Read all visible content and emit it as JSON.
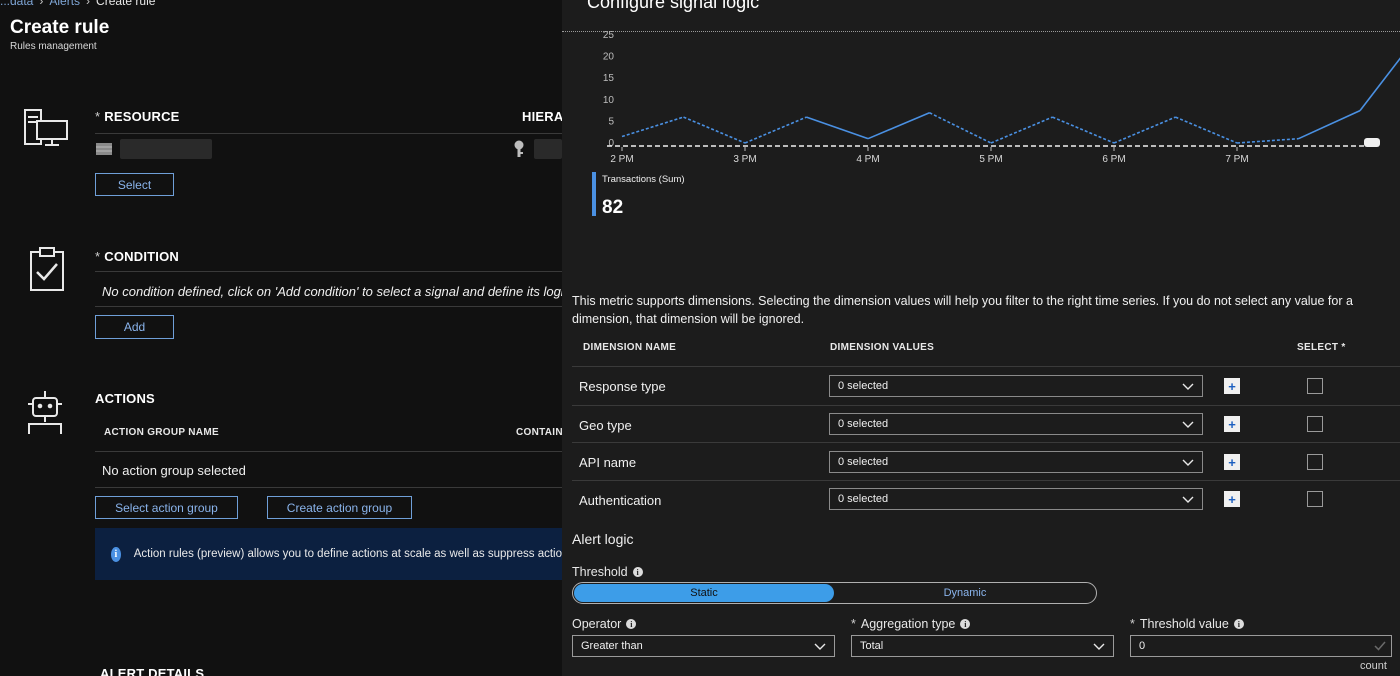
{
  "breadcrumb": {
    "items": [
      "...data",
      "Alerts",
      "Create rule"
    ]
  },
  "page": {
    "title": "Create rule",
    "subtitle": "Rules management"
  },
  "resource": {
    "label": "RESOURCE",
    "hierarchy_label": "HIERA",
    "select_button": "Select",
    "icon": "server-monitor-icon"
  },
  "condition": {
    "label": "CONDITION",
    "empty_text": "No condition defined, click on 'Add condition' to select a signal and define its logic",
    "add_button": "Add",
    "icon": "clipboard-check-icon"
  },
  "actions": {
    "label": "ACTIONS",
    "col_group_name": "ACTION GROUP NAME",
    "col_contains": "CONTAIN",
    "empty_text": "No action group selected",
    "select_button": "Select action group",
    "create_button": "Create action group",
    "icon": "robot-icon",
    "banner_text": "Action rules (preview) allows you to define actions at scale as well as suppress actio"
  },
  "alert_details": {
    "label": "ALERT DETAILS"
  },
  "signal_panel": {
    "title": "Configure signal logic",
    "chart_data": {
      "type": "line",
      "x_ticks": [
        "2 PM",
        "3 PM",
        "4 PM",
        "5 PM",
        "6 PM",
        "7 PM"
      ],
      "y_ticks": [
        "25",
        "20",
        "15",
        "10",
        "5",
        "0"
      ],
      "ylim": [
        0,
        25
      ],
      "series": [
        {
          "name": "Transactions (Sum)",
          "x": [
            0,
            0.5,
            1,
            1.5,
            2,
            2.5,
            3,
            3.5,
            4,
            4.5,
            5,
            5.5,
            6,
            6.5
          ],
          "y": [
            1.5,
            6,
            0,
            6,
            1,
            7,
            0,
            6,
            0,
            6,
            0,
            1,
            7.5,
            26
          ],
          "dashed_segments": [
            0,
            1,
            2,
            5,
            6,
            7,
            8,
            9,
            10
          ]
        }
      ],
      "threshold_line": 0
    },
    "legend": {
      "label": "Transactions (Sum)",
      "value": "82"
    },
    "dimension_desc": "This metric supports dimensions. Selecting the dimension values will help you filter to the right time series. If you do not select any value for a dimension, that dimension will be ignored.",
    "dimensions": {
      "col_name": "DIMENSION NAME",
      "col_values": "DIMENSION VALUES",
      "col_select": "SELECT *",
      "rows": [
        {
          "name": "Response type",
          "value": "0 selected"
        },
        {
          "name": "Geo type",
          "value": "0 selected"
        },
        {
          "name": "API name",
          "value": "0 selected"
        },
        {
          "name": "Authentication",
          "value": "0 selected"
        }
      ]
    },
    "alert_logic": {
      "heading": "Alert logic",
      "threshold_label": "Threshold",
      "threshold_options": [
        "Static",
        "Dynamic"
      ],
      "threshold_selected": "Static",
      "operator_label": "Operator",
      "operator_value": "Greater than",
      "aggregation_label": "Aggregation type",
      "aggregation_value": "Total",
      "threshold_value_label": "Threshold value",
      "threshold_value": "0",
      "threshold_unit": "count"
    }
  },
  "colors": {
    "accent": "#4a90e2",
    "toggle_active": "#3d9de8",
    "banner_bg": "#0c2040"
  }
}
